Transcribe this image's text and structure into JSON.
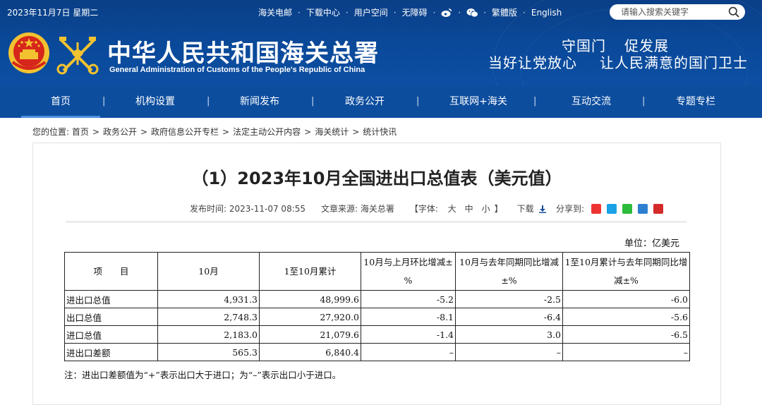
{
  "topbar": {
    "date": "2023年11月7日 星期二",
    "links": [
      "海关电邮",
      "下载中心",
      "用户空间",
      "无障碍"
    ],
    "icons": [
      "weibo-icon",
      "wechat-icon"
    ],
    "lang_links": [
      "繁體版",
      "English"
    ],
    "search_placeholder": "请输入搜索关键字"
  },
  "header": {
    "name_cn": "中华人民共和国海关总署",
    "name_en": "General Administration of Customs of the People's Republic of China",
    "slogan_line1": [
      "守国门",
      "促发展"
    ],
    "slogan_line2": [
      "当好让党放心",
      "让人民满意的国门卫士"
    ]
  },
  "nav": {
    "items": [
      "首页",
      "机构设置",
      "新闻发布",
      "政务公开",
      "互联网+海关",
      "互动交流",
      "专题专栏"
    ],
    "active": "首页"
  },
  "breadcrumb": {
    "prefix": "您的位置:",
    "items": [
      "首页",
      "政务公开",
      "政府信息公开专栏",
      "法定主动公开内容",
      "海关统计",
      "统计快讯"
    ]
  },
  "article": {
    "title": "（1）2023年10月全国进出口总值表（美元值）",
    "publish_label": "发布时间:",
    "publish_time": "2023-11-07 08:55",
    "source_label": "文章来源:",
    "source": "海关总署",
    "font_label_open": "【字体:",
    "font_sizes": [
      "大",
      "中",
      "小"
    ],
    "font_label_close": "】",
    "download": "下载",
    "share_label": "分享到:",
    "share_icons": [
      "weibo",
      "qzone",
      "wechat",
      "renren",
      "pdf"
    ]
  },
  "table": {
    "unit": "单位：亿美元",
    "headers": [
      "项　　目",
      "10月",
      "1至10月累计",
      "10月与上月环比增减±%",
      "10月与去年同期同比增减±%",
      "1至10月累计与去年同期同比增减±%"
    ],
    "rows": [
      [
        "进出口总值",
        "4,931.3",
        "48,999.6",
        "-5.2",
        "-2.5",
        "-6.0"
      ],
      [
        "出口总值",
        "2,748.3",
        "27,920.0",
        "-8.1",
        "-6.4",
        "-5.6"
      ],
      [
        "进口总值",
        "2,183.0",
        "21,079.6",
        "-1.4",
        "3.0",
        "-6.5"
      ],
      [
        "进出口差额",
        "565.3",
        "6,840.4",
        "–",
        "–",
        "–"
      ]
    ],
    "note": "注：进出口差额值为“+”表示出口大于进口；为“–”表示出口小于进口。"
  },
  "colors": {
    "banner_blue": "#0a4898",
    "nav_blue": "#0c4d9e",
    "emblem_red": "#d7261b",
    "emblem_gold": "#f2c230"
  }
}
